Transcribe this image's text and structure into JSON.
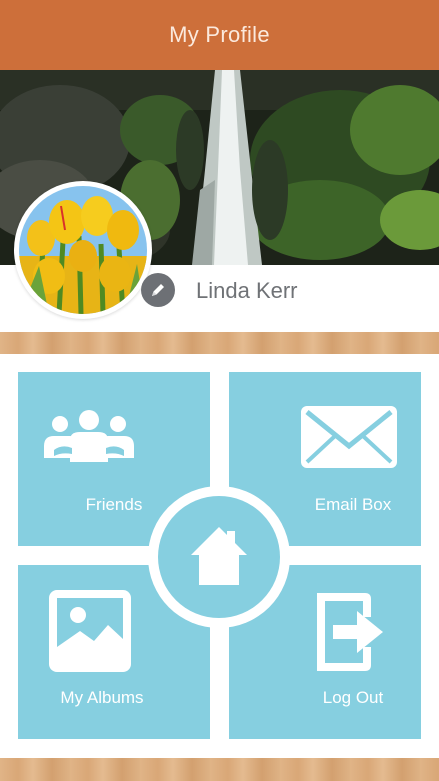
{
  "header": {
    "title": "My Profile"
  },
  "profile": {
    "name": "Linda Kerr"
  },
  "tiles": [
    {
      "label": "Friends",
      "icon": "friends-group-icon"
    },
    {
      "label": "Email Box",
      "icon": "envelope-icon"
    },
    {
      "label": "My Albums",
      "icon": "photo-album-icon"
    },
    {
      "label": "Log Out",
      "icon": "logout-arrow-icon"
    }
  ],
  "center_button": {
    "icon": "home-icon"
  },
  "colors": {
    "header": "#cd6f3a",
    "tile": "#86cfe0",
    "edit_button": "#6d7075",
    "name_text": "#6f7276"
  }
}
